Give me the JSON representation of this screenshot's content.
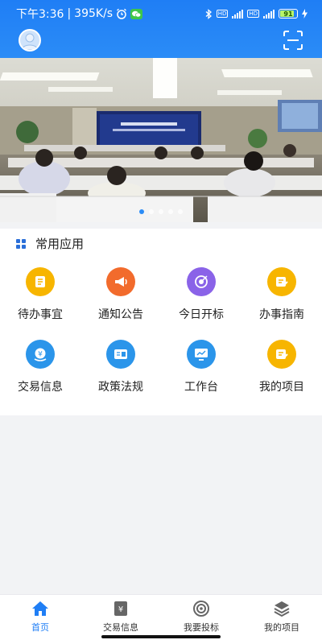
{
  "status_bar": {
    "time": "下午3:36",
    "network_speed": "395K/s",
    "battery_level": "91"
  },
  "header": {
    "avatar_icon": "avatar-icon",
    "scan_icon": "scan-icon",
    "background_color": "#1f7ef5"
  },
  "banner": {
    "slide_count": 5,
    "active_slide": 1
  },
  "apps": {
    "section_title": "常用应用",
    "items": [
      {
        "label": "待办事宜",
        "icon": "todo-icon",
        "color": "#f7b500"
      },
      {
        "label": "通知公告",
        "icon": "megaphone-icon",
        "color": "#f26b2c"
      },
      {
        "label": "今日开标",
        "icon": "target-icon",
        "color": "#8a63e8"
      },
      {
        "label": "办事指南",
        "icon": "guide-icon",
        "color": "#f7b500"
      },
      {
        "label": "交易信息",
        "icon": "trade-icon",
        "color": "#2b95ea"
      },
      {
        "label": "政策法规",
        "icon": "policy-icon",
        "color": "#2b95ea"
      },
      {
        "label": "工作台",
        "icon": "workbench-icon",
        "color": "#2b95ea"
      },
      {
        "label": "我的项目",
        "icon": "project-icon",
        "color": "#f7b500"
      }
    ]
  },
  "tabbar": {
    "items": [
      {
        "label": "首页",
        "icon": "home-icon",
        "active": true
      },
      {
        "label": "交易信息",
        "icon": "document-icon",
        "active": false
      },
      {
        "label": "我要投标",
        "icon": "target-icon",
        "active": false
      },
      {
        "label": "我的项目",
        "icon": "layers-icon",
        "active": false
      }
    ],
    "active_color": "#1f7ef5"
  }
}
